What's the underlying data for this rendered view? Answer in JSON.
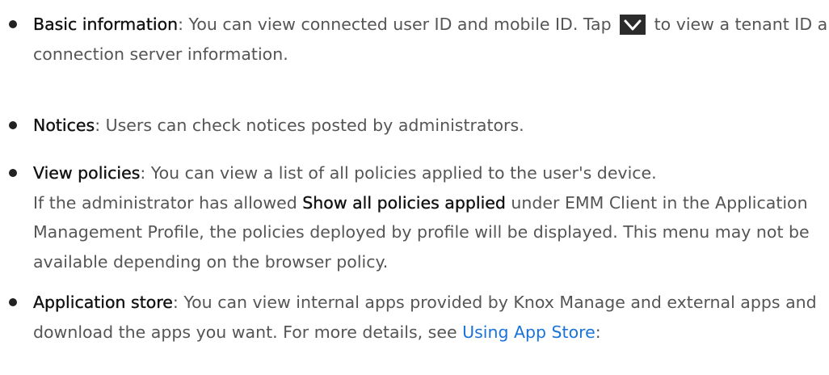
{
  "items": [
    {
      "term": "Basic information",
      "text_a": ": You can view connected user ID and mobile ID. Tap ",
      "icon": "chevron-down-icon",
      "text_b": " to view a tenant ID and connection server information."
    },
    {
      "term": "Notices",
      "text": ": Users can check notices posted by administrators."
    },
    {
      "term": "View policies",
      "text_a": ": You can view a list of all policies applied to the user's device.",
      "text_b": "If the administrator has allowed ",
      "strong": "Show all policies applied",
      "text_c": " under EMM Client in the Application Management Profile, the policies deployed by profile will be displayed. This menu may not be available depending on the browser policy."
    },
    {
      "term": "Application store",
      "text_a": ": You can view internal apps provided by Knox Manage and external apps and download the apps you want. For more details, see ",
      "link": "Using App Store",
      "text_b": ":"
    }
  ],
  "colors": {
    "text": "#555555",
    "term": "#111111",
    "link": "#1a73d9",
    "icon_bg": "#2b2b2b"
  }
}
